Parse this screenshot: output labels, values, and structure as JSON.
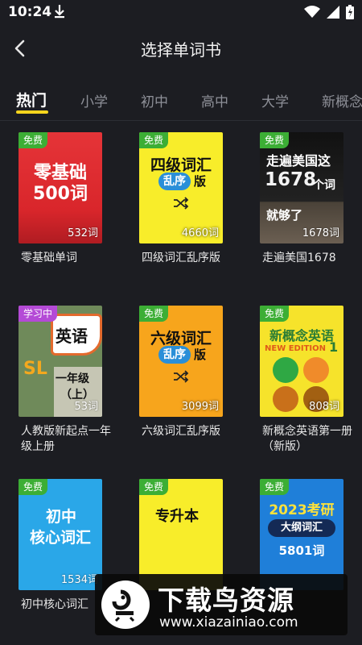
{
  "status": {
    "time": "10:24"
  },
  "header": {
    "title": "选择单词书"
  },
  "tabs": [
    "热门",
    "小学",
    "初中",
    "高中",
    "大学",
    "新概念"
  ],
  "books": [
    {
      "badge": "免费",
      "count": "532词",
      "title": "零基础单词",
      "cover": [
        "零基础",
        "500词"
      ]
    },
    {
      "badge": "免费",
      "count": "4660词",
      "title": "四级词汇乱序版",
      "cover": [
        "四级词汇",
        "乱序",
        "版"
      ]
    },
    {
      "badge": "免费",
      "count": "1678词",
      "title": "走遍美国1678",
      "cover": [
        "走遍美国这",
        "1678",
        "个词",
        "就够了"
      ]
    },
    {
      "badge": "学习中",
      "count": "53词",
      "title": "人教版新起点一年级上册",
      "cover": [
        "英语",
        "SL",
        "一年级",
        "（上）"
      ]
    },
    {
      "badge": "免费",
      "count": "3099词",
      "title": "六级词汇乱序版",
      "cover": [
        "六级词汇",
        "乱序",
        "版"
      ]
    },
    {
      "badge": "免费",
      "count": "808词",
      "title": "新概念英语第一册（新版）",
      "cover": [
        "新概念英语",
        "NEW EDITION",
        "1"
      ]
    },
    {
      "badge": "免费",
      "count": "1534词",
      "title": "初中核心词汇",
      "cover": [
        "初中",
        "核心词汇"
      ]
    },
    {
      "badge": "免费",
      "count": "",
      "title": "",
      "cover": [
        "专升本"
      ]
    },
    {
      "badge": "免费",
      "count": "",
      "title": "",
      "cover": [
        "2023考研",
        "大纲词汇",
        "5801词"
      ]
    }
  ],
  "watermark": {
    "title": "下载鸟资源",
    "url": "www.xiazainiao.com"
  },
  "colors": {
    "background": "#1c1d22",
    "accent": "#f7d51d",
    "free_badge": "#3cae35",
    "learning_badge": "#b44ad6"
  },
  "icons": [
    "download-icon",
    "wifi-icon",
    "signal-icon",
    "battery-icon",
    "back-icon",
    "shuffle-icon"
  ]
}
